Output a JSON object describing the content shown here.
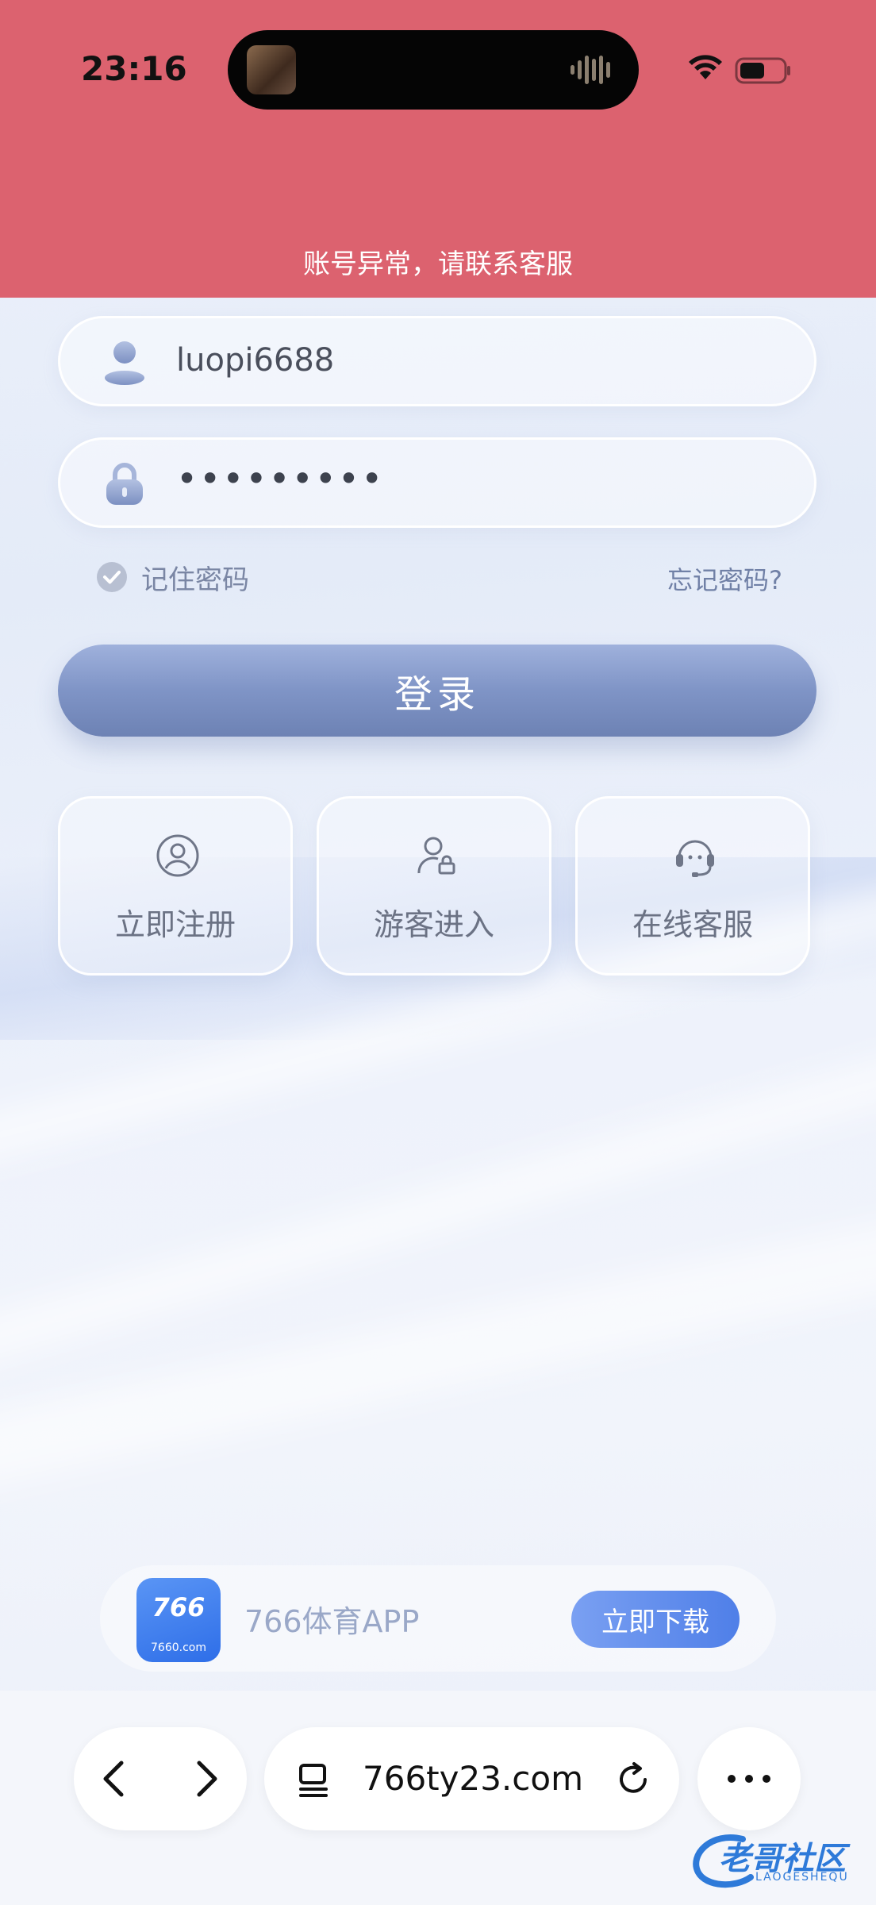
{
  "status_bar": {
    "time": "23:16"
  },
  "banner": {
    "text": "账号异常，请联系客服"
  },
  "login": {
    "username": "luopi6688",
    "password_masked": "•••••••••",
    "remember_label": "记住密码",
    "forgot_label": "忘记密码?",
    "submit_label": "登录"
  },
  "quick_actions": [
    {
      "label": "立即注册",
      "icon": "user-circle-icon"
    },
    {
      "label": "游客进入",
      "icon": "guest-icon"
    },
    {
      "label": "在线客服",
      "icon": "headset-icon"
    }
  ],
  "promo": {
    "logo_text": "766",
    "logo_domain": "7660.com",
    "text": "766体育APP",
    "download_label": "立即下载"
  },
  "browser": {
    "url": "766ty23.com"
  },
  "watermark": {
    "text": "老哥社区",
    "sub": "LAOGESHEQU"
  },
  "colors": {
    "banner": "#dc626f",
    "login_button": "#7f94c6",
    "download_button": "#4f7fe8",
    "background": "#eef2fb"
  }
}
